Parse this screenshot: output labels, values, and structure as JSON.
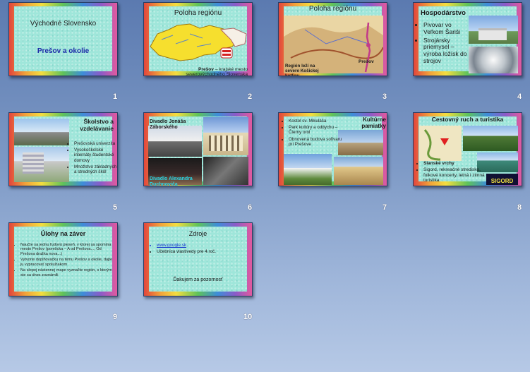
{
  "slides": [
    {
      "number": "1",
      "title": "Východné Slovensko",
      "subtitle": "Prešov a okolie"
    },
    {
      "number": "2",
      "title": "Poloha regiónu",
      "caption_bold": "Prešov",
      "caption_rest": " – krajské mesto severovýchodného  Slovenska"
    },
    {
      "number": "3",
      "title": "Poloha regiónu",
      "caption": "Región leží na severe Košickej kotliny",
      "map_label": "Prešov"
    },
    {
      "number": "4",
      "title": "Hospodárstvo",
      "bullets": [
        "Pivovar vo Veľkom Šariši",
        "Strojársky priemysel – výroba ložísk do strojov"
      ]
    },
    {
      "number": "5",
      "title": "Školstvo a vzdelávanie",
      "bullets": [
        "Prešovská univerzita",
        "Vysokoškolské internáty študentské domovy",
        "Množstvo základných a stredných škôl"
      ]
    },
    {
      "number": "6",
      "title": "Divadlo Jonáša Záborského",
      "caption": "Divadlo Alexandra Duchnoviča"
    },
    {
      "number": "7",
      "title": "Kultúrne pamiatky",
      "bullets": [
        "Kostol sv. Mikuláša",
        "Park kultúry a oddychu – Čierny orol",
        "Obnovená budova soľivaru pri Prešove"
      ]
    },
    {
      "number": "8",
      "title": "Cestovný ruch a turistika",
      "bullets": [
        "Slanské vrchy",
        "Sigord, rekreačné stredisko, folkové koncerty, letná i zimná turistika"
      ],
      "logo_text": "SIGORD"
    },
    {
      "number": "9",
      "title": "Úlohy na záver",
      "bullets": [
        "Naučte sa jednu ľudovú pieseň, v ktorej sa spomína mesto Prešov (pomôcka – A od Prešova..., Od Prešova dražka nova...)",
        "Vytvorte doplňovačku na tému Prešov a okolie, dajte ju vypracovať spolužiakom",
        "Na slepej nástennej mape vyznačte región, s ktorým ste sa dnes zoznámili"
      ]
    },
    {
      "number": "10",
      "title": "Zdroje",
      "link": "www.google.sk",
      "bullet2": "Učebnica vlastivedy pre 4.roč.",
      "thanks": "Ďakujem za pozornosť"
    }
  ]
}
